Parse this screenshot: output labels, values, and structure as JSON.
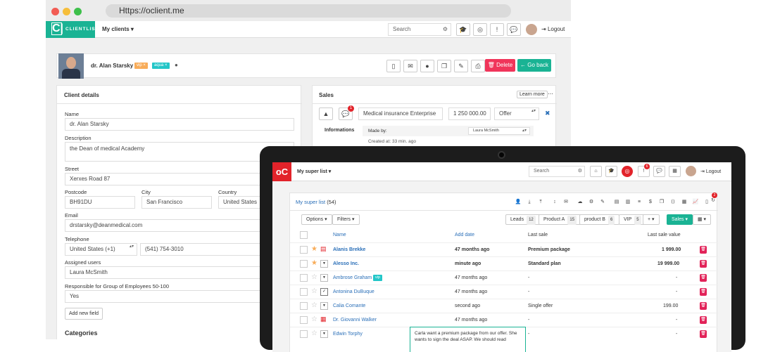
{
  "browser": {
    "url": "Https://oclient.me",
    "logo_mark": "C|",
    "logo_text": "CLIENTLIST",
    "nav_menu": "My clients",
    "search_placeholder": "Search",
    "logout": "Logout",
    "colors": {
      "brand": "#1ab394",
      "danger": "#f0355a"
    }
  },
  "profile": {
    "name": "dr. Alan Starsky",
    "tags": [
      "vip",
      "aqua"
    ],
    "delete_label": "Delete",
    "goback_label": "Go back"
  },
  "client_details": {
    "title": "Client details",
    "name_label": "Name",
    "name_value": "dr. Alan Starsky",
    "description_label": "Description",
    "description_value": "the Dean of medical Academy",
    "street_label": "Street",
    "street_value": "Xerxes Road 87",
    "postcode_label": "Postcode",
    "postcode_value": "BH91DU",
    "city_label": "City",
    "city_value": "San Francisco",
    "country_label": "Country",
    "country_value": "United States",
    "email_label": "Email",
    "email_value": "drstarsky@deanmedical.com",
    "telephone_label": "Telephone",
    "phone_country": "United States (+1)",
    "phone_value": "(541) 754-3010",
    "assigned_label": "Assigned users",
    "assigned_value": "Laura McSmith",
    "responsible_label": "Responsible for Group of Employees 50-100",
    "responsible_value": "Yes",
    "add_field": "Add new field",
    "categories": "Categories"
  },
  "sales": {
    "title": "Sales",
    "learn_more": "Learn more",
    "comment_badge": "1",
    "deal_name": "Medical insurance Enterprise",
    "amount": "1 250 000.00",
    "stage": "Offer",
    "informations_label": "Informations",
    "made_by_label": "Made by:",
    "made_by_value": "Laura McSmith",
    "created_at": "Created at: 33 min. ago"
  },
  "tablet": {
    "logo": "oC",
    "nav_menu": "My super list",
    "search_placeholder": "Search",
    "logout": "Logout",
    "notif_badge": "6",
    "list_title": "My super list",
    "list_count": "(54)",
    "corner_badge": "2",
    "options_label": "Options",
    "filters_label": "Filters",
    "tags": [
      {
        "label": "Leads",
        "count": "12"
      },
      {
        "label": "Product A",
        "count": "15"
      },
      {
        "label": "product B",
        "count": "6"
      },
      {
        "label": "VIP",
        "count": "5"
      }
    ],
    "sales_button": "Sales",
    "columns": [
      "Name",
      "Add date",
      "Last sale",
      "Last sale value"
    ],
    "rows": [
      {
        "name": "Alanis Brekke",
        "date": "47 months ago",
        "sale": "Premium package",
        "value": "1 999.00",
        "bold": true,
        "star": true
      },
      {
        "name": "Alesso Inc.",
        "date": "minute ago",
        "sale": "Standard plan",
        "value": "19 999.00",
        "bold": true,
        "star": true
      },
      {
        "name": "Ambrose Graham",
        "tag": "vip",
        "date": "47 months ago",
        "sale": "-",
        "value": "-"
      },
      {
        "name": "Antonina DuBuque",
        "date": "47 months ago",
        "sale": "-",
        "value": "-"
      },
      {
        "name": "Calia Comante",
        "date": "second ago",
        "sale": "Single offer",
        "value": "199.00"
      },
      {
        "name": "Dr. Giovanni Walker",
        "date": "47 months ago",
        "sale": "-",
        "value": "-"
      },
      {
        "name": "Edwin Torphy",
        "date": "",
        "sale": "-",
        "value": "-"
      }
    ],
    "tooltip_text": "Carla want a premium package from our offer. She wants to sign the deal ASAP. We should read"
  }
}
